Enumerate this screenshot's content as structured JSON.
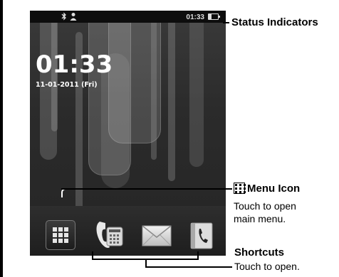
{
  "phone": {
    "status_bar": {
      "time": "01:33"
    },
    "clock": {
      "time": "01:33",
      "date": "11-01-2011 (Fri)"
    }
  },
  "callouts": {
    "status": {
      "title": "Status Indicators"
    },
    "menu": {
      "title": "Menu Icon",
      "text_line1": "Touch to open",
      "text_line2": "main menu."
    },
    "shortcuts": {
      "title": "Shortcuts",
      "text": "Touch to open."
    }
  },
  "icons": {
    "bluetooth": "bluetooth-icon",
    "contact": "person-icon",
    "battery": "battery-icon",
    "menu": "grid-menu-icon",
    "phone": "phone-icon",
    "messages": "envelope-icon",
    "contacts": "contacts-book-icon"
  },
  "colors": {
    "status_bar": "#0d0d0d",
    "screen": "#2b2b2b",
    "text": "#000000",
    "clock": "#ffffff"
  }
}
